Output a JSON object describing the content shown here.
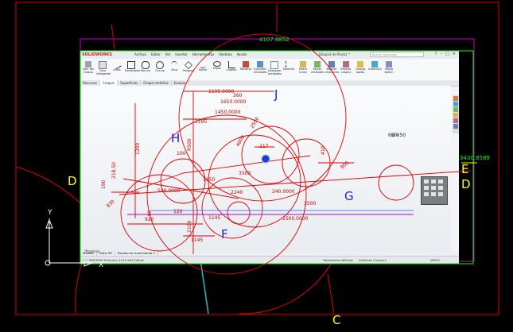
{
  "app": {
    "logo": "SOLIDWORKS",
    "menu": [
      "Archivo",
      "Editar",
      "Ver",
      "Insertar",
      "Herramientas",
      "Ventana",
      "Ayuda"
    ],
    "document_title": "Dibujo3 de Pieza1 *",
    "search_placeholder": "Buscar comandos",
    "window_controls": [
      "?",
      "–",
      "□",
      "×"
    ]
  },
  "ribbon": {
    "buttons": [
      "Salir del croquis",
      "Cota inteligente",
      "Línea",
      "Rectángulo",
      "Ranura",
      "Círculo",
      "Arco",
      "Polígono",
      "Spline",
      "Elipse",
      "Chaflán",
      "Recortar",
      "Convertir entidades",
      "Desplazar entidades",
      "Simetría",
      "Matriz lineal",
      "Mover entidades",
      "Mostrar relaciones",
      "Reparar croquis",
      "Croquis rápido",
      "Instant2D",
      "Rapid sketch"
    ]
  },
  "tabs": [
    "Recursos",
    "Croquis",
    "Superficies",
    "Chapa metálica",
    "Evaluar"
  ],
  "model_tabs": [
    "Modelo",
    "Vista 3D",
    "Estudio de movimiento 1"
  ],
  "status": {
    "product": "SOLIDWORKS Premium 2015 x64 Edition",
    "state": "Totalmente definido",
    "editing": "Editando Croquis3",
    "units": "MMGS"
  },
  "cad": {
    "big_letters": [
      "H",
      "J",
      "D",
      "D",
      "E",
      "F",
      "G",
      "C"
    ],
    "green_coords": [
      "4107.8852",
      "3430.8589"
    ],
    "dims": [
      "360",
      "1195.0000",
      "1650.0000",
      "1450.0000",
      "1195",
      "R500",
      "100",
      "1200",
      "2240",
      "90",
      "120",
      "920",
      "930",
      "190",
      "218.50",
      "540.0000",
      "650",
      "900",
      "217",
      "410",
      "240.0000",
      "3500",
      "2500.0000",
      "3500",
      "4000",
      "1150",
      "2100",
      "1145",
      "1145",
      "2500"
    ],
    "phi_650": "Ø 650",
    "axis_y": "Y",
    "axis_x": "X",
    "origin_label": "*Posterior"
  },
  "colors": {
    "background": "#000000",
    "cad_red": "#e00000",
    "cad_yellow": "#ffff00",
    "cad_magenta": "#c000c0",
    "cad_green": "#00ff00",
    "cad_blue": "#2020d0",
    "sw_red": "#c0282d"
  }
}
